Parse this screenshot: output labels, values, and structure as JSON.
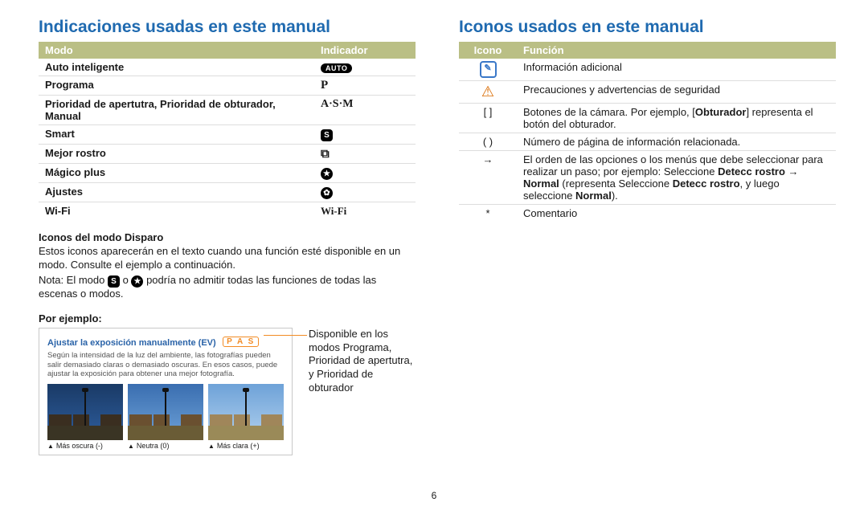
{
  "page_number": "6",
  "left": {
    "heading": "Indicaciones usadas en este manual",
    "table_headers": {
      "modo": "Modo",
      "indicador": "Indicador"
    },
    "rows": [
      {
        "modo": "Auto inteligente",
        "indicador": "AUTO"
      },
      {
        "modo": "Programa",
        "indicador": "P"
      },
      {
        "modo": "Prioridad de apertutra, Prioridad de obturador, Manual",
        "indicador": "A·S·M"
      },
      {
        "modo": "Smart",
        "indicador": "S"
      },
      {
        "modo": "Mejor rostro",
        "indicador": "⬚"
      },
      {
        "modo": "Mágico plus",
        "indicador": "★"
      },
      {
        "modo": "Ajustes",
        "indicador": "✿"
      },
      {
        "modo": "Wi-Fi",
        "indicador": "Wi-Fi"
      }
    ],
    "sub1_title": "Iconos del modo Disparo",
    "sub1_p1": "Estos iconos aparecerán en el texto cuando una función esté disponible en un modo. Consulte el ejemplo a continuación.",
    "sub1_p2_pre": "Nota: El modo ",
    "sub1_p2_mid": " o ",
    "sub1_p2_post": " podría no admitir todas las funciones de todas las escenas o modos.",
    "por_ejemplo": "Por ejemplo:",
    "example_title": "Ajustar la exposición manualmente (EV)",
    "example_modes": "P A S",
    "example_desc": "Según la intensidad de la luz del ambiente, las fotografías pueden salir demasiado claras o demasiado oscuras. En esos casos, puede ajustar la exposición para obtener una mejor fotografía.",
    "photos": [
      {
        "cap": "Más oscura (-)"
      },
      {
        "cap": "Neutra (0)"
      },
      {
        "cap": "Más clara (+)"
      }
    ],
    "callout": "Disponible en los modos Programa, Prioridad de apertutra, y Prioridad de obturador"
  },
  "right": {
    "heading": "Iconos usados en este manual",
    "table_headers": {
      "icono": "Icono",
      "funcion": "Función"
    },
    "rows": [
      {
        "icono": "note",
        "funcion": "Información adicional"
      },
      {
        "icono": "warn",
        "funcion": "Precauciones y advertencias de seguridad"
      },
      {
        "icono": "[ ]",
        "funcion_pre": "Botones de la cámara. Por ejemplo, [",
        "funcion_bold": "Obturador",
        "funcion_post": "] representa el botón del obturador."
      },
      {
        "icono": "( )",
        "funcion": "Número de página de información relacionada."
      },
      {
        "icono": "→",
        "funcion_pre": "El orden de las opciones o los menús que debe seleccionar para realizar un paso; por ejemplo: Seleccione ",
        "funcion_b1": "Detecc rostro",
        "funcion_mid1": " → ",
        "funcion_b2": "Normal",
        "funcion_mid2": " (representa Seleccione ",
        "funcion_b3": "Detecc rostro",
        "funcion_mid3": ", y luego seleccione ",
        "funcion_b4": "Normal",
        "funcion_post": ")."
      },
      {
        "icono": "*",
        "funcion": "Comentario"
      }
    ]
  }
}
